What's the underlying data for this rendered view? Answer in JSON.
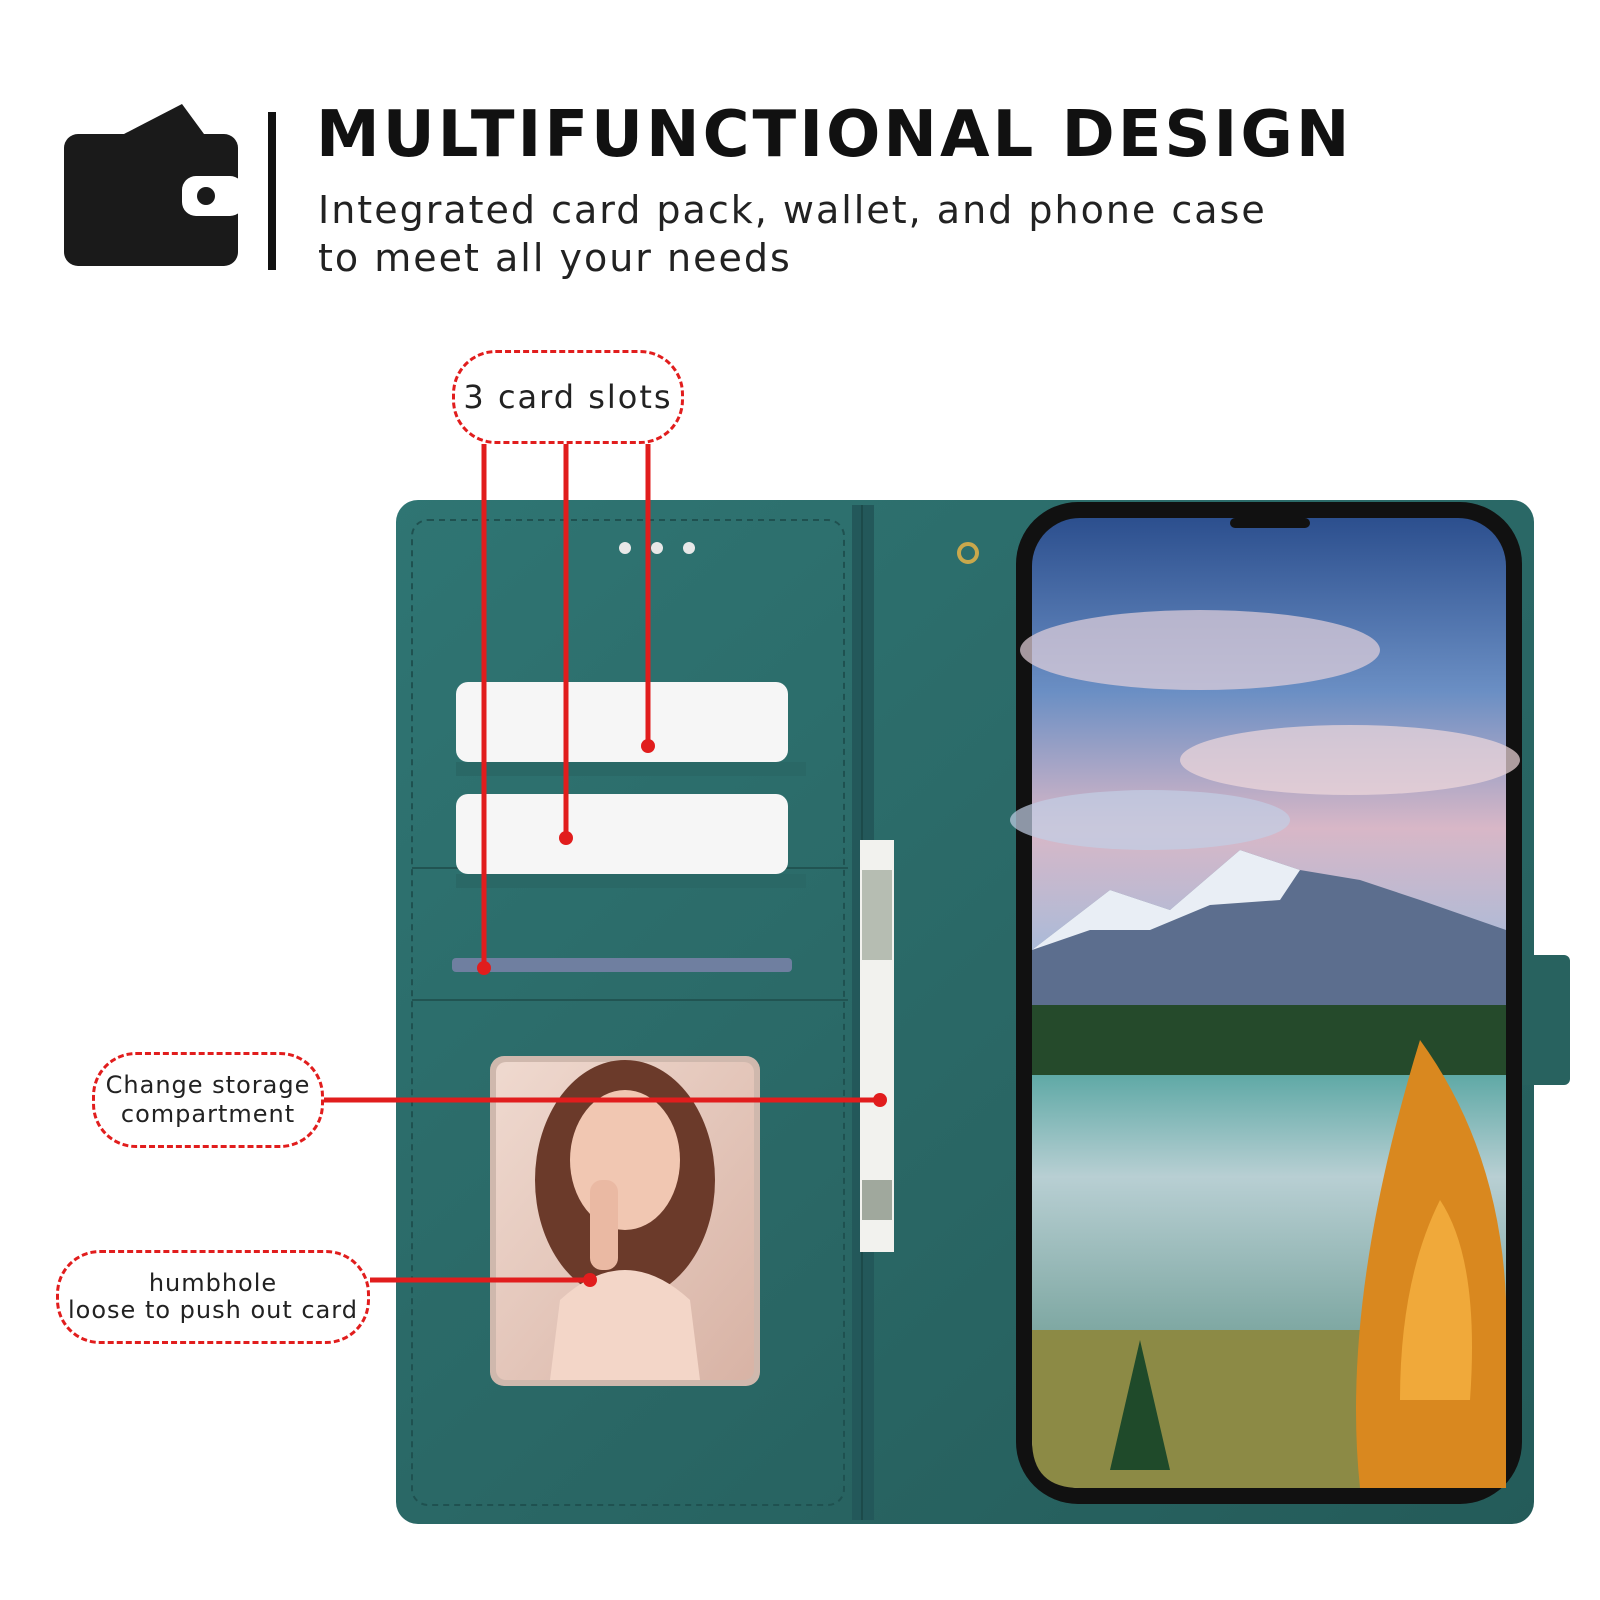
{
  "header": {
    "icon": "wallet-icon",
    "title": "MULTIFUNCTIONAL DESIGN",
    "subtitle_line1": "Integrated card pack, wallet, and phone case",
    "subtitle_line2": "to meet all your needs"
  },
  "callouts": {
    "card_slots": "3 card slots",
    "change_storage_line1": "Change storage",
    "change_storage_line2": "compartment",
    "thumbhole_line1": "humbhole",
    "thumbhole_line2": "loose to push out card"
  },
  "colors": {
    "callout_accent": "#e11d1d",
    "case_leather": "#2c6e6c",
    "icon_dark": "#1a1a1a"
  }
}
